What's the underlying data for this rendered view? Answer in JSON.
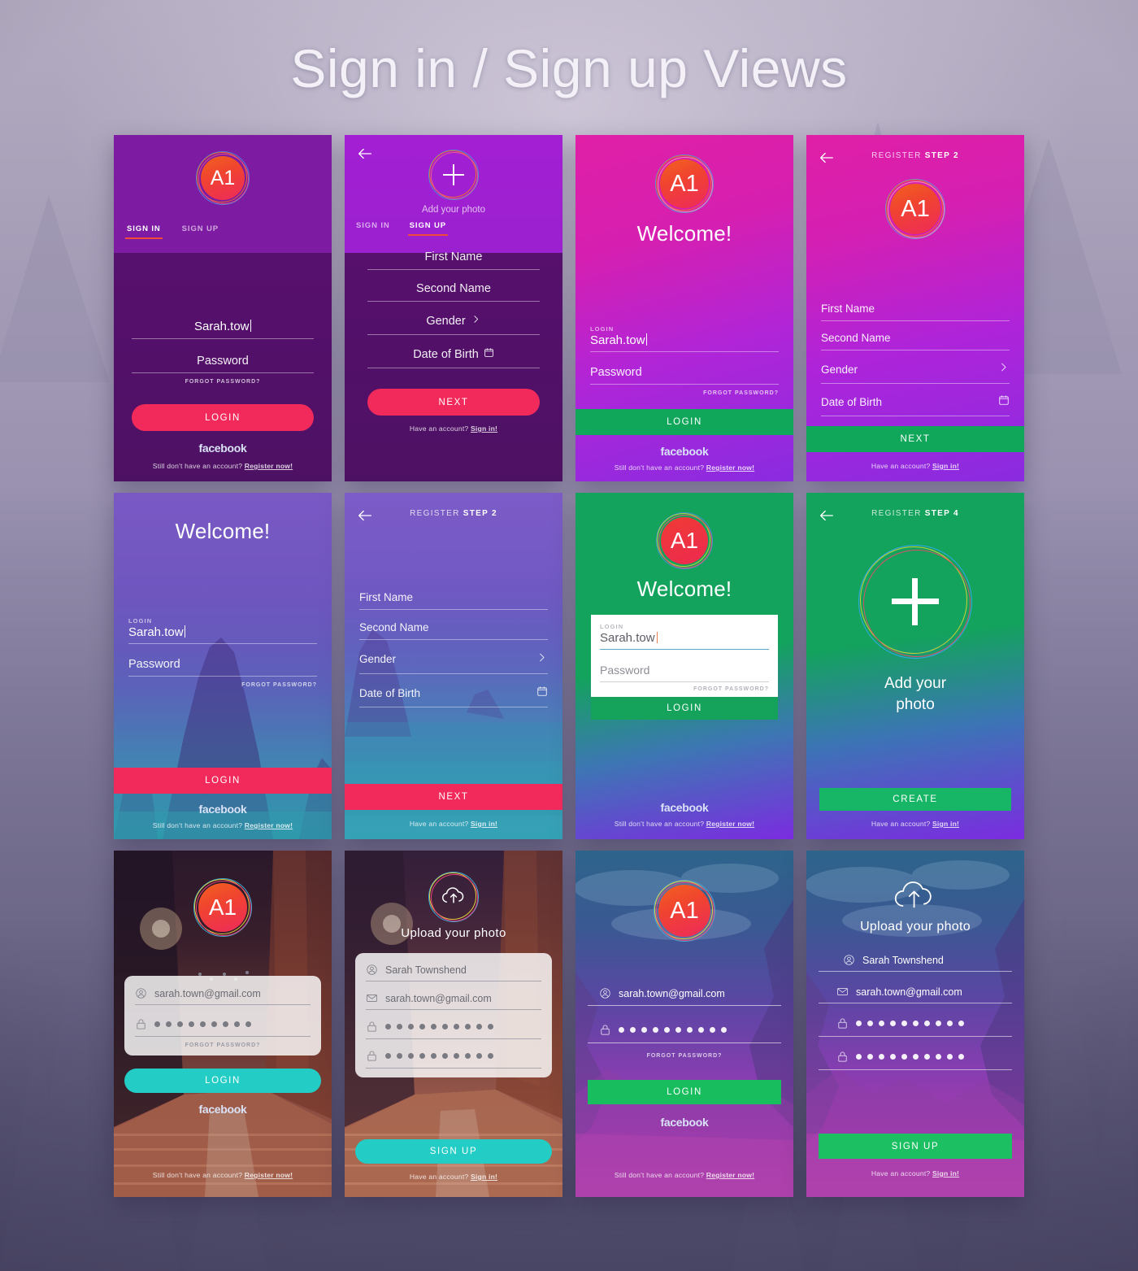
{
  "page": {
    "title": "Sign in / Sign up Views"
  },
  "common": {
    "logo_text": "A1",
    "facebook": "facebook",
    "footnote_register": "Still don't have an account?",
    "footnote_register_link": "Register now!",
    "footnote_signin": "Have an account?",
    "footnote_signin_link": "Sign in!",
    "forgot_password": "FORGOT PASSWORD?",
    "login_label": "LOGIN",
    "login_caption": "LOGIN",
    "password_placeholder": "Password",
    "username_value": "Sarah.tow",
    "email_value": "sarah.town@gmail.com",
    "fullname_value": "Sarah Townshend",
    "first_name": "First Name",
    "second_name": "Second Name",
    "gender": "Gender",
    "date_of_birth": "Date of Birth",
    "next_label": "NEXT",
    "create_label": "CREATE",
    "signup_label": "SIGN UP",
    "welcome": "Welcome!",
    "add_your_photo": "Add your photo",
    "add_your_photo_l1": "Add your",
    "add_your_photo_l2": "photo",
    "upload_your_photo": "Upload your photo",
    "tab_sign_in": "SIGN IN",
    "tab_sign_up": "SIGN UP",
    "register_word": "REGISTER",
    "step_2": "STEP 2",
    "step_4": "STEP 4",
    "password_dots_count": 9,
    "password_dots_count_10": 10
  },
  "colors": {
    "accent_pink": "#f22a5b",
    "accent_red_underline": "#ef4a3a",
    "accent_green": "#17a95f",
    "accent_teal": "#25cdc4",
    "logo_orange": "#f2621f",
    "logo_pink": "#ee2a5b",
    "facebook_blue": "#d9e2f7",
    "page_bg": "#8d85a2"
  },
  "screens": [
    {
      "id": "s1",
      "name": "sign-in-tabs-purple",
      "header_style": "tabs",
      "active_tab": "SIGN IN"
    },
    {
      "id": "s2",
      "name": "sign-up-tabs-purple",
      "header_style": "tabs",
      "active_tab": "SIGN UP"
    },
    {
      "id": "s3",
      "name": "welcome-login-magenta",
      "header_style": "none"
    },
    {
      "id": "s4",
      "name": "register-step2-magenta",
      "header_style": "titlebar",
      "title_step": "STEP 2"
    },
    {
      "id": "s5",
      "name": "welcome-login-photo-sea",
      "header_style": "none"
    },
    {
      "id": "s6",
      "name": "register-step2-photo-sea",
      "header_style": "titlebar",
      "title_step": "STEP 2"
    },
    {
      "id": "s7",
      "name": "welcome-login-green-card",
      "header_style": "none"
    },
    {
      "id": "s8",
      "name": "register-step4-green",
      "header_style": "titlebar",
      "title_step": "STEP 4"
    },
    {
      "id": "s9",
      "name": "login-city-glass",
      "header_style": "none"
    },
    {
      "id": "s10",
      "name": "signup-city-glass",
      "header_style": "none"
    },
    {
      "id": "s11",
      "name": "login-canyon",
      "header_style": "none"
    },
    {
      "id": "s12",
      "name": "signup-canyon",
      "header_style": "none"
    }
  ]
}
